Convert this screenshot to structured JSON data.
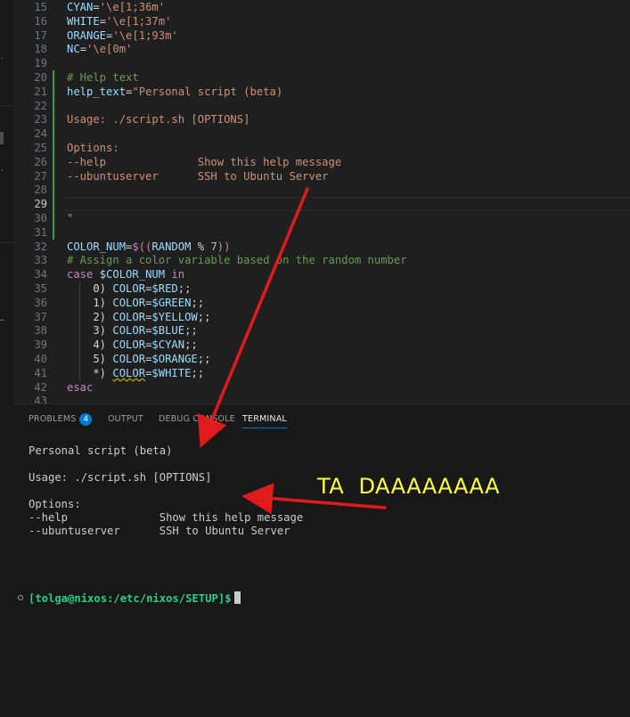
{
  "editor": {
    "lines": [
      {
        "n": "15",
        "tokens": [
          [
            "c-var",
            "CYAN"
          ],
          [
            "c-op",
            "="
          ],
          [
            "c-str",
            "'\\e[1;36m'"
          ]
        ]
      },
      {
        "n": "16",
        "tokens": [
          [
            "c-var",
            "WHITE"
          ],
          [
            "c-op",
            "="
          ],
          [
            "c-str",
            "'\\e[1;37m'"
          ]
        ]
      },
      {
        "n": "17",
        "tokens": [
          [
            "c-var",
            "ORANGE"
          ],
          [
            "c-op",
            "="
          ],
          [
            "c-str",
            "'\\e[1;93m'"
          ]
        ]
      },
      {
        "n": "18",
        "tokens": [
          [
            "c-var",
            "NC"
          ],
          [
            "c-op",
            "="
          ],
          [
            "c-str",
            "'\\e[0m'"
          ]
        ]
      },
      {
        "n": "19",
        "tokens": []
      },
      {
        "n": "20",
        "tokens": [
          [
            "c-com",
            "# Help text"
          ]
        ]
      },
      {
        "n": "21",
        "tokens": [
          [
            "c-var",
            "help_text"
          ],
          [
            "c-op",
            "="
          ],
          [
            "c-str",
            "\"Personal script (beta)"
          ]
        ]
      },
      {
        "n": "22",
        "tokens": []
      },
      {
        "n": "23",
        "tokens": [
          [
            "c-str",
            "Usage: ./script.sh [OPTIONS]"
          ]
        ]
      },
      {
        "n": "24",
        "tokens": []
      },
      {
        "n": "25",
        "tokens": [
          [
            "c-str",
            "Options:"
          ]
        ]
      },
      {
        "n": "26",
        "tokens": [
          [
            "c-str",
            "--help              Show this help message"
          ]
        ]
      },
      {
        "n": "27",
        "tokens": [
          [
            "c-str",
            "--ubuntuserver      SSH to Ubuntu Server"
          ]
        ]
      },
      {
        "n": "28",
        "tokens": []
      },
      {
        "n": "29",
        "tokens": []
      },
      {
        "n": "30",
        "tokens": [
          [
            "c-str",
            "\""
          ]
        ]
      },
      {
        "n": "31",
        "tokens": []
      },
      {
        "n": "32",
        "tokens": [
          [
            "c-var",
            "COLOR_NUM"
          ],
          [
            "c-op",
            "="
          ],
          [
            "c-dollar",
            "$(("
          ],
          [
            "c-var",
            "RANDOM"
          ],
          [
            "c-op",
            " % "
          ],
          [
            "c-num",
            "7"
          ],
          [
            "c-dollar",
            "))"
          ]
        ]
      },
      {
        "n": "33",
        "tokens": [
          [
            "c-com",
            "# Assign a color variable based on the random number"
          ]
        ]
      },
      {
        "n": "34",
        "tokens": [
          [
            "c-kw",
            "case"
          ],
          [
            "c-op",
            " "
          ],
          [
            "c-var",
            "$COLOR_NUM"
          ],
          [
            "c-op",
            " "
          ],
          [
            "c-kw",
            "in"
          ]
        ]
      },
      {
        "n": "35",
        "tokens": [
          [
            "c-op",
            "    0) "
          ],
          [
            "c-var",
            "COLOR"
          ],
          [
            "c-op",
            "="
          ],
          [
            "c-var",
            "$RED"
          ],
          [
            "c-op",
            ";;"
          ]
        ]
      },
      {
        "n": "36",
        "tokens": [
          [
            "c-op",
            "    1) "
          ],
          [
            "c-var",
            "COLOR"
          ],
          [
            "c-op",
            "="
          ],
          [
            "c-var",
            "$GREEN"
          ],
          [
            "c-op",
            ";;"
          ]
        ]
      },
      {
        "n": "37",
        "tokens": [
          [
            "c-op",
            "    2) "
          ],
          [
            "c-var",
            "COLOR"
          ],
          [
            "c-op",
            "="
          ],
          [
            "c-var",
            "$YELLOW"
          ],
          [
            "c-op",
            ";;"
          ]
        ]
      },
      {
        "n": "38",
        "tokens": [
          [
            "c-op",
            "    3) "
          ],
          [
            "c-var",
            "COLOR"
          ],
          [
            "c-op",
            "="
          ],
          [
            "c-var",
            "$BLUE"
          ],
          [
            "c-op",
            ";;"
          ]
        ]
      },
      {
        "n": "39",
        "tokens": [
          [
            "c-op",
            "    4) "
          ],
          [
            "c-var",
            "COLOR"
          ],
          [
            "c-op",
            "="
          ],
          [
            "c-var",
            "$CYAN"
          ],
          [
            "c-op",
            ";;"
          ]
        ]
      },
      {
        "n": "40",
        "tokens": [
          [
            "c-op",
            "    5) "
          ],
          [
            "c-var",
            "COLOR"
          ],
          [
            "c-op",
            "="
          ],
          [
            "c-var",
            "$ORANGE"
          ],
          [
            "c-op",
            ";;"
          ]
        ]
      },
      {
        "n": "41",
        "tokens": [
          [
            "c-op",
            "    *) "
          ],
          [
            "c-squiggle",
            "COLOR"
          ],
          [
            "c-op",
            "="
          ],
          [
            "c-var",
            "$WHITE"
          ],
          [
            "c-op",
            ";;"
          ]
        ]
      },
      {
        "n": "42",
        "tokens": [
          [
            "c-kw",
            "esac"
          ]
        ]
      },
      {
        "n": "43",
        "tokens": []
      }
    ],
    "active_line": "29"
  },
  "panel": {
    "tabs": {
      "problems": "PROBLEMS",
      "problems_count": "4",
      "output": "OUTPUT",
      "debug_console": "DEBUG CONSOLE",
      "terminal": "TERMINAL"
    },
    "terminal_lines": [
      "Personal script (beta)",
      "",
      "Usage: ./script.sh [OPTIONS]",
      "",
      "Options:",
      "--help              Show this help message",
      "--ubuntuserver      SSH to Ubuntu Server"
    ],
    "prompt": "[tolga@nixos:/etc/nixos/SETUP]$"
  },
  "annotation": {
    "text": "TA  DAAAAAAAA",
    "color": "#ffff3b",
    "arrow_color": "#e01b1b"
  }
}
